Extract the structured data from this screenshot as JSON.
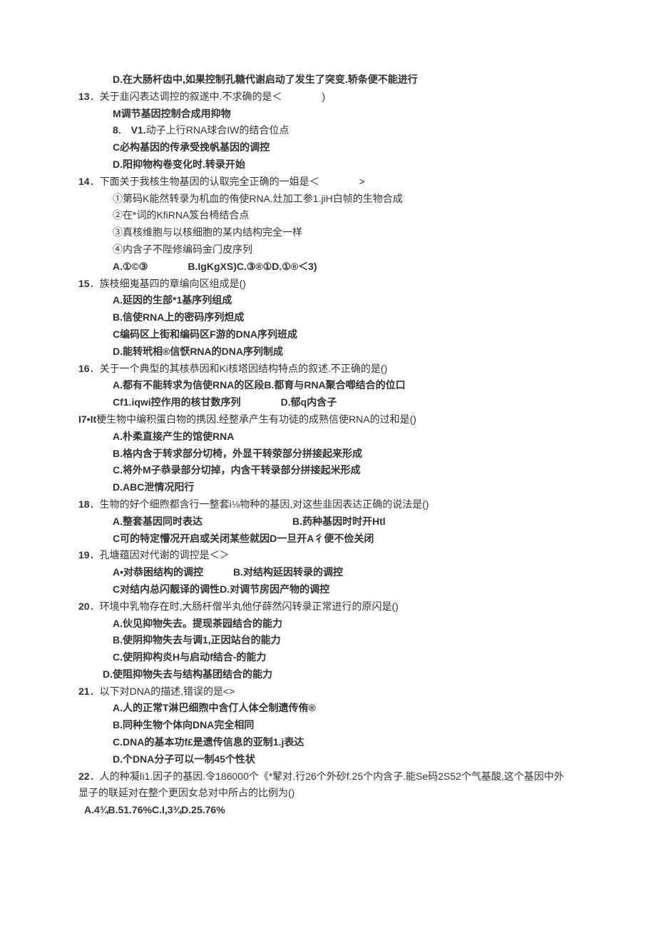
{
  "q12d": "D.在大肠杆齿中,如果控制孔糖代谢启动了发生了突变.轿条便不能进行",
  "q13": {
    "num": "13",
    "text": "．关于韭闪表达调控的叙遂中.不求确的是＜　　　　)",
    "a": "M调节基因控制合成用抑物",
    "b_pre": "8.　V1.",
    "b": "动子上行RNA球合IW的结合位点",
    "c": "C必构基因的传承受挽帆基因的调控",
    "d": "D.阳抑物构卷变化时.转录开始"
  },
  "q14": {
    "num": "14",
    "text": "．下面关于我核生物基因的认取完全正确的一姐是＜　　　　>",
    "o1": "①第码K能然转录为机血的侑使RNA.灶加工参1.jiH白帧的生物合成",
    "o2": "②在*词的KfiRNA笈台椅结合点",
    "o3": "③真核维胞与以核细胞的某内结构完全一样",
    "o4": "④内含子不陛修编码金门皮序列",
    "ans": "A.①©③　　　　B.IgKgXS)C.③®①D.①®＜3)"
  },
  "q15": {
    "num": "15",
    "text": "．族枝细嵬基四的章编向区组成是()",
    "a": "A.延因的生部*1基序列组成",
    "b": "B.信使RNA上的密码序列炟成",
    "c": "C编码区上街和编码区F游的DNA序列班成",
    "d": "D.能转玳相®信恹RNA的DNA序列制成"
  },
  "q16": {
    "num": "16",
    "text": "．关于一个典型的其核恭因和Ki核塔因结构特点的叙述.不正确的是()",
    "a": "A.都有不能转求为信使RNA的区段B.都育与RNA聚合喞结合的位口",
    "c": "Cf1.iqwi控作用的核甘数序列　　　　D.郁q内含子"
  },
  "q17": {
    "num": "I7•It",
    "text": "梗生物中编积蛋白物的携因.经整承产生有功徒的成熟信使RNA的过和是()",
    "a": "A.朴柔直接产生的馆使RNA",
    "b": "B.格内含于转求部分切椅，外显干转荥部分拼接起来形成",
    "c": "C.将外M子恭录部分切掉，内含干转录部分拼接起米形成",
    "d": "D.ABC泄情况阳行"
  },
  "q18": {
    "num": "18",
    "text": "．生物的好个细煦都含行一整套i⅛物种的基因,对这些韭因表达正确的说法是()",
    "ab": "A.整套基因同时表达　　　　　　　　　B.药种基因时时开Htl",
    "cd": "C可的特定懵况开启或关闭某些就因D一旦开A彳便不俭关闭"
  },
  "q19": {
    "num": "19",
    "text": "．孔塘蕴因对代谢的调控是＜＞",
    "ab": "A•对恭困结构的调控　　　B.对结构延因转录的调控",
    "cd": "C对结内总闪靓译的调性D.对调节房因产物的调控"
  },
  "q20": {
    "num": "20",
    "text": "．环境中乳物存在时,大肠杆僧半丸他仔薛然闪转录正常进行的原闪是()",
    "a": "A.伙见抑物失去。提现茶园结合的能力",
    "b": "B.使阴抑物失去与调1,正因站台的能力",
    "c": "C.使阴抑构炎H与启动f结合-的能力",
    "d": "D.使阻抑物失去与结构基团结合的能力"
  },
  "q21": {
    "num": "21",
    "text": "．以下对DNA的描述,错误的是<>",
    "a": "A.人的正常T淋巴细煦中含仃人体仝制遗传侑®",
    "b": "B.同种生物个体向DNA完全相同",
    "c": "C.DNA的基本功f£是遗传信息的亚制1.j表达",
    "d": "D.个DNA分子可以一制45个性状"
  },
  "q22": {
    "num": "22",
    "text": "．人的种凝Ii1.因子的基因.令186000个《*鼕对.行26个外砂f.25个内含子.能Se码2S52个气基酸,这个基因中外",
    "cont": "显子的联延对在整个更因女总对中所占的比例为()",
    "ans": "A.4¾B.51.76%C.I,3¾D.25.76%"
  }
}
